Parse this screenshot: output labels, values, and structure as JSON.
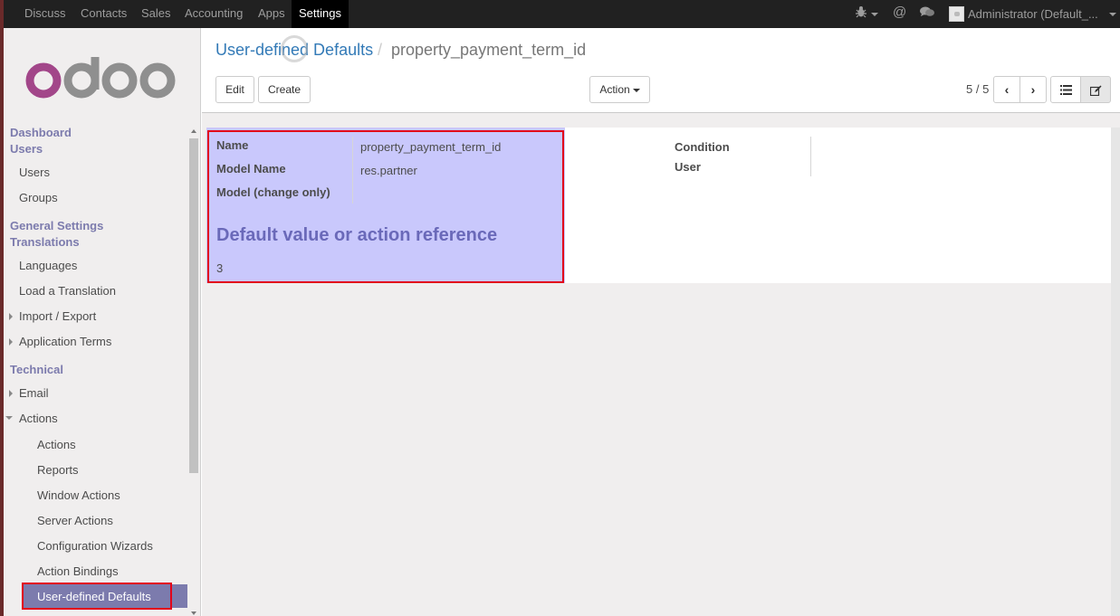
{
  "topbar": {
    "menu": [
      "Discuss",
      "Contacts",
      "Sales",
      "Accounting",
      "Apps",
      "Settings"
    ],
    "active_menu": "Settings",
    "user": "Administrator (Default_..."
  },
  "sidebar": {
    "logo_text": "odoo",
    "dashboard": "Dashboard",
    "users_header": "Users",
    "users_items": [
      "Users",
      "Groups"
    ],
    "general_settings": "General Settings",
    "translations_header": "Translations",
    "translation_items": [
      "Languages",
      "Load a Translation",
      "Import / Export",
      "Application Terms"
    ],
    "technical_header": "Technical",
    "technical_items": [
      "Email",
      "Actions"
    ],
    "actions_items": [
      "Actions",
      "Reports",
      "Window Actions",
      "Server Actions",
      "Configuration Wizards",
      "Action Bindings",
      "User-defined Defaults"
    ]
  },
  "control": {
    "breadcrumb_link": "User-defined Defaults",
    "breadcrumb_sep": "/",
    "breadcrumb_active": "property_payment_term_id",
    "edit_label": "Edit",
    "create_label": "Create",
    "action_label": "Action",
    "pager": "5 / 5"
  },
  "form": {
    "name_label": "Name",
    "name_value": "property_payment_term_id",
    "model_label": "Model Name",
    "model_value": "res.partner",
    "model_change_label": "Model (change only)",
    "condition_label": "Condition",
    "user_label": "User",
    "section_title": "Default value or action reference",
    "default_value": "3"
  },
  "colors": {
    "sidebar_accent": "#7c7bad",
    "highlight": "#c9c8fc",
    "annotation_box": "#e2001a",
    "link": "#337ab7"
  }
}
